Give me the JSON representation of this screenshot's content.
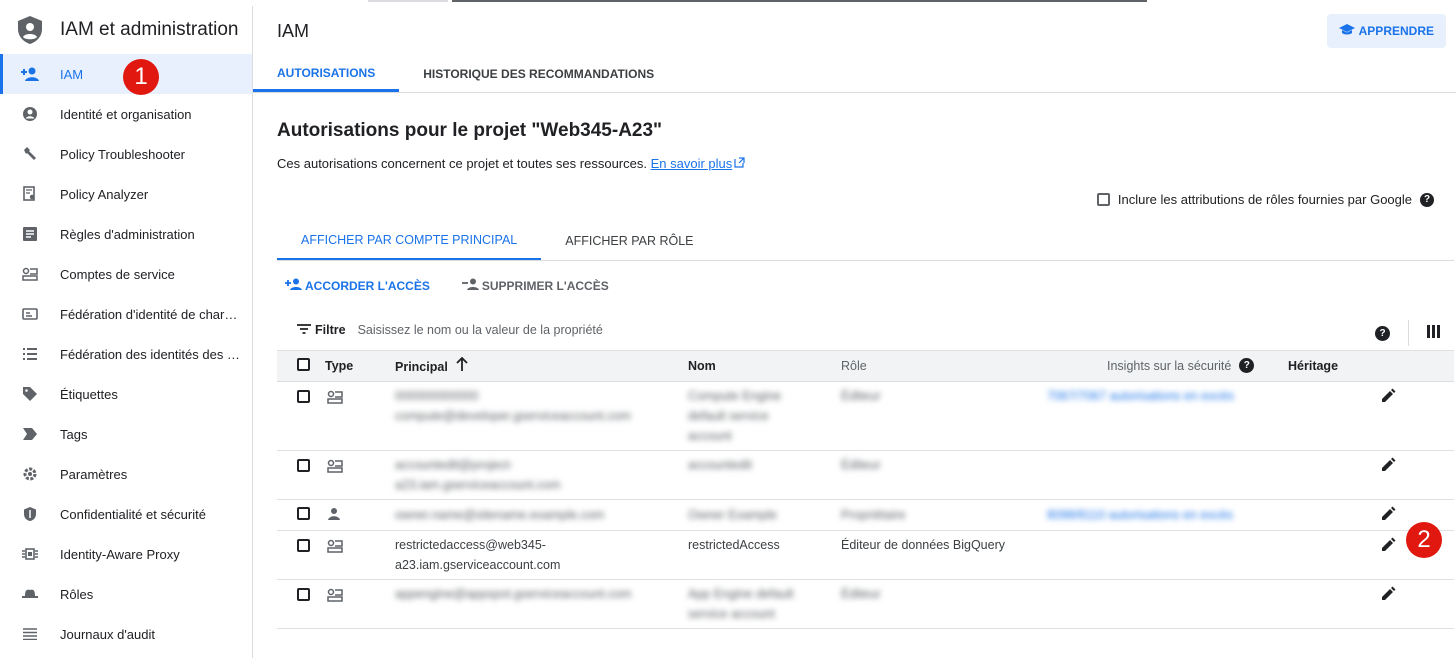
{
  "sidebar": {
    "title": "IAM et administration",
    "items": [
      {
        "label": "IAM",
        "icon": "person-add-icon"
      },
      {
        "label": "Identité et organisation",
        "icon": "account-circle-icon"
      },
      {
        "label": "Policy Troubleshooter",
        "icon": "wrench-icon"
      },
      {
        "label": "Policy Analyzer",
        "icon": "document-search-icon"
      },
      {
        "label": "Règles d'administration",
        "icon": "list-document-icon"
      },
      {
        "label": "Comptes de service",
        "icon": "service-account-icon"
      },
      {
        "label": "Fédération d'identité de char…",
        "icon": "badge-icon"
      },
      {
        "label": "Fédération des identités des …",
        "icon": "list-icon"
      },
      {
        "label": "Étiquettes",
        "icon": "label-icon"
      },
      {
        "label": "Tags",
        "icon": "tag-arrow-icon"
      },
      {
        "label": "Paramètres",
        "icon": "gear-icon"
      },
      {
        "label": "Confidentialité et sécurité",
        "icon": "shield-icon"
      },
      {
        "label": "Identity-Aware Proxy",
        "icon": "proxy-icon"
      },
      {
        "label": "Rôles",
        "icon": "hat-icon"
      },
      {
        "label": "Journaux d'audit",
        "icon": "lines-icon"
      }
    ]
  },
  "markers": {
    "one": "1",
    "two": "2"
  },
  "header": {
    "title": "IAM",
    "learn_label": "APPRENDRE"
  },
  "tabs": {
    "permissions": "AUTORISATIONS",
    "history": "HISTORIQUE DES RECOMMANDATIONS"
  },
  "page": {
    "title": "Autorisations pour le projet \"Web345-A23\"",
    "description": "Ces autorisations concernent ce projet et toutes ses ressources.",
    "learn_more": "En savoir plus",
    "include_label": "Inclure les attributions de rôles fournies par Google"
  },
  "subtabs": {
    "by_principal": "AFFICHER PAR COMPTE PRINCIPAL",
    "by_role": "AFFICHER PAR RÔLE"
  },
  "actions": {
    "grant": "ACCORDER L'ACCÈS",
    "remove": "SUPPRIMER L'ACCÈS"
  },
  "filter": {
    "label": "Filtre",
    "placeholder": "Saisissez le nom ou la valeur de la propriété"
  },
  "table": {
    "headers": {
      "type": "Type",
      "principal": "Principal",
      "name": "Nom",
      "role": "Rôle",
      "insights": "Insights sur la sécurité",
      "inheritance": "Héritage"
    },
    "rows": [
      {
        "principal_lines": [
          "000000000000",
          "compute@developer.gserviceaccount.com"
        ],
        "name_lines": [
          "Compute Engine",
          "default service",
          "account"
        ],
        "role": "Éditeur",
        "insights": "7067/7067 autorisations en excès",
        "type_icon": "service-account-icon",
        "blurred": true
      },
      {
        "principal_lines": [
          "accountedit@project-",
          "a23.iam.gserviceaccount.com"
        ],
        "name_lines": [
          "accountedit"
        ],
        "role": "Éditeur",
        "insights": "",
        "type_icon": "service-account-icon",
        "blurred": true
      },
      {
        "principal_lines": [
          "owner.name@sitename.example.com"
        ],
        "name_lines": [
          "Owner Example"
        ],
        "role": "Propriétaire",
        "insights": "8098/8110 autorisations en excès",
        "type_icon": "person-icon",
        "blurred": true
      },
      {
        "principal_lines": [
          "restrictedaccess@web345-",
          "a23.iam.gserviceaccount.com"
        ],
        "name_lines": [
          "restrictedAccess"
        ],
        "role": "Éditeur de données BigQuery",
        "insights": "",
        "type_icon": "service-account-icon",
        "blurred": false
      },
      {
        "principal_lines": [
          "appengine@appspot.gserviceaccount.com"
        ],
        "name_lines": [
          "App Engine default",
          "service account"
        ],
        "role": "Éditeur",
        "insights": "",
        "type_icon": "service-account-icon",
        "blurred": true
      }
    ]
  }
}
